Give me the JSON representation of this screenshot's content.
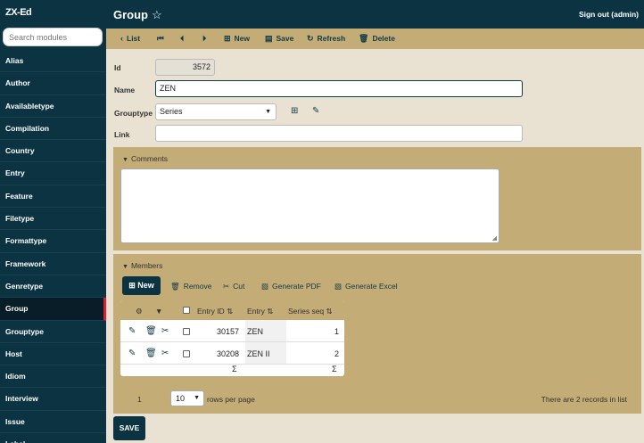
{
  "app": {
    "brand": "ZX-Ed"
  },
  "sidebar": {
    "search_placeholder": "Search modules",
    "items": [
      {
        "label": "Alias"
      },
      {
        "label": "Author"
      },
      {
        "label": "Availabletype"
      },
      {
        "label": "Compilation"
      },
      {
        "label": "Country"
      },
      {
        "label": "Entry"
      },
      {
        "label": "Feature"
      },
      {
        "label": "Filetype"
      },
      {
        "label": "Formattype"
      },
      {
        "label": "Framework"
      },
      {
        "label": "Genretype"
      },
      {
        "label": "Group"
      },
      {
        "label": "Grouptype"
      },
      {
        "label": "Host"
      },
      {
        "label": "Idiom"
      },
      {
        "label": "Interview"
      },
      {
        "label": "Issue"
      },
      {
        "label": "Label"
      }
    ],
    "active": "Group"
  },
  "header": {
    "title": "Group",
    "star_icon": "star-outline-icon",
    "signout": "Sign out (admin)"
  },
  "toolbar": {
    "list": "List",
    "new": "New",
    "save": "Save",
    "refresh": "Refresh",
    "delete": "Delete"
  },
  "form": {
    "id_label": "Id",
    "id_value": "3572",
    "name_label": "Name",
    "name_value": "ZEN",
    "grouptype_label": "Grouptype",
    "grouptype_value": "Series",
    "link_label": "Link",
    "link_value": ""
  },
  "comments": {
    "title": "Comments",
    "value": ""
  },
  "members": {
    "title": "Members",
    "actions": {
      "new": "New",
      "remove": "Remove",
      "cut": "Cut",
      "pdf": "Generate PDF",
      "excel": "Generate Excel"
    },
    "columns": {
      "entry_id": "Entry ID",
      "entry": "Entry",
      "series_seq": "Series seq"
    },
    "rows": [
      {
        "entry_id": "30157",
        "entry": "ZEN",
        "seq": "1"
      },
      {
        "entry_id": "30208",
        "entry": "ZEN II",
        "seq": "2"
      }
    ],
    "footer_sum": "Σ",
    "pager": {
      "page": "1",
      "per_page": "10",
      "per_page_label": "rows per page",
      "records": "There are 2 records in list"
    }
  },
  "save_button": "SAVE",
  "colors": {
    "dark": "#0b3342",
    "tan": "#c4ac76",
    "bg": "#e9e1d2",
    "active_bar": "#e01e2e"
  }
}
